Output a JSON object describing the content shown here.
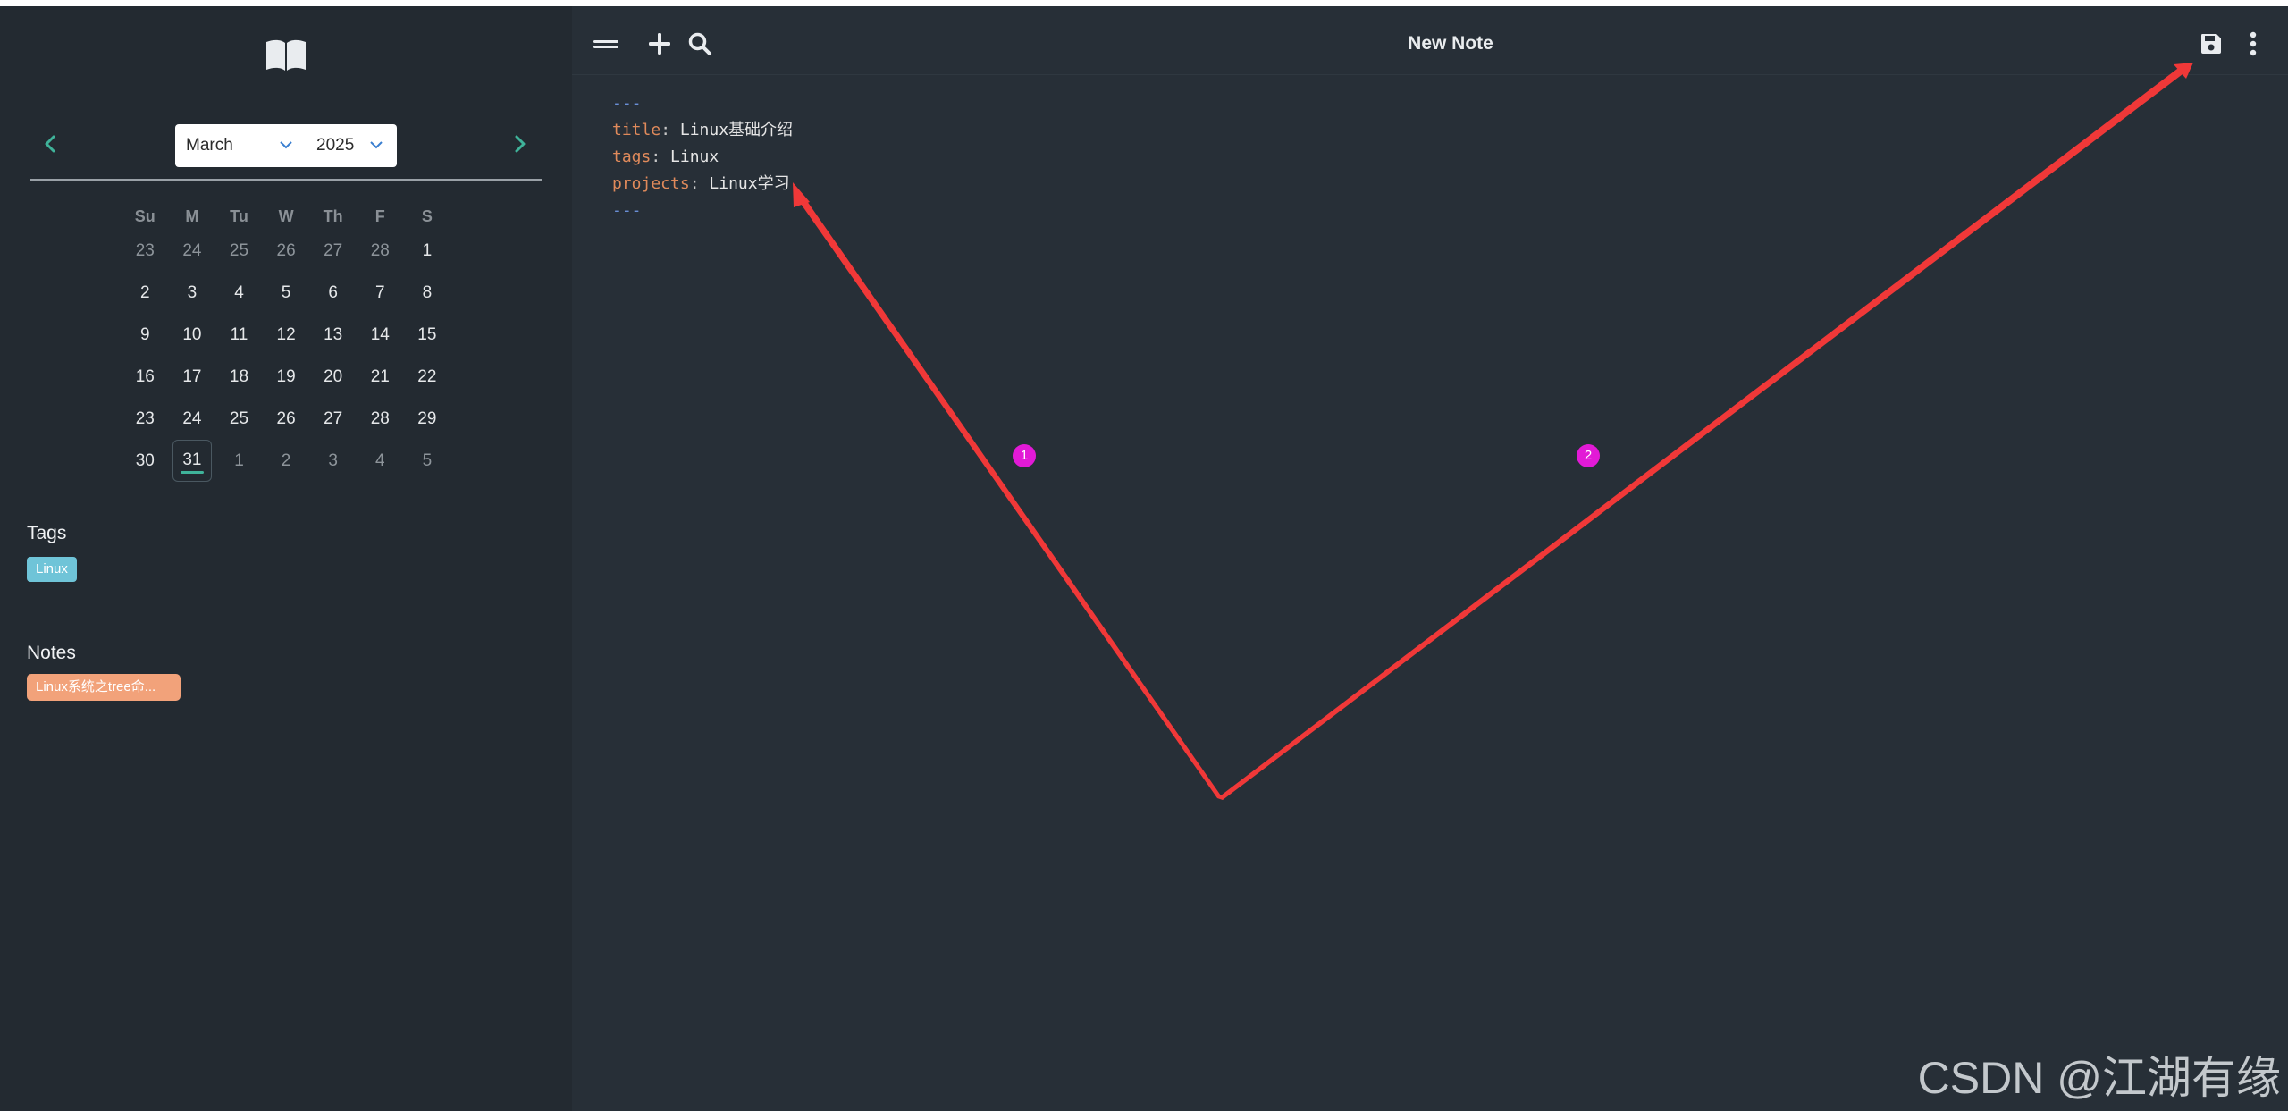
{
  "sidebar": {
    "logo_icon": "open-book-icon",
    "calendar": {
      "prev_icon": "chevron-left-icon",
      "next_icon": "chevron-right-icon",
      "month": "March",
      "year": "2025",
      "weekdays": [
        "Su",
        "M",
        "Tu",
        "W",
        "Th",
        "F",
        "S"
      ],
      "weeks": [
        [
          {
            "d": "23",
            "muted": true
          },
          {
            "d": "24",
            "muted": true
          },
          {
            "d": "25",
            "muted": true
          },
          {
            "d": "26",
            "muted": true
          },
          {
            "d": "27",
            "muted": true
          },
          {
            "d": "28",
            "muted": true
          },
          {
            "d": "1"
          }
        ],
        [
          {
            "d": "2"
          },
          {
            "d": "3"
          },
          {
            "d": "4"
          },
          {
            "d": "5"
          },
          {
            "d": "6"
          },
          {
            "d": "7"
          },
          {
            "d": "8"
          }
        ],
        [
          {
            "d": "9"
          },
          {
            "d": "10"
          },
          {
            "d": "11"
          },
          {
            "d": "12"
          },
          {
            "d": "13"
          },
          {
            "d": "14"
          },
          {
            "d": "15"
          }
        ],
        [
          {
            "d": "16"
          },
          {
            "d": "17"
          },
          {
            "d": "18"
          },
          {
            "d": "19"
          },
          {
            "d": "20"
          },
          {
            "d": "21"
          },
          {
            "d": "22"
          }
        ],
        [
          {
            "d": "23"
          },
          {
            "d": "24"
          },
          {
            "d": "25"
          },
          {
            "d": "26"
          },
          {
            "d": "27"
          },
          {
            "d": "28"
          },
          {
            "d": "29"
          }
        ],
        [
          {
            "d": "30"
          },
          {
            "d": "31",
            "today": true
          },
          {
            "d": "1",
            "muted": true
          },
          {
            "d": "2",
            "muted": true
          },
          {
            "d": "3",
            "muted": true
          },
          {
            "d": "4",
            "muted": true
          },
          {
            "d": "5",
            "muted": true
          }
        ]
      ],
      "accent_color": "#3fb39a"
    },
    "tags_title": "Tags",
    "tags": [
      "Linux"
    ],
    "tag_color": "#6fc4d8",
    "notes_title": "Notes",
    "notes": [
      "Linux系统之tree命..."
    ],
    "note_color": "#f2a27a"
  },
  "toolbar": {
    "menu_icon": "hamburger-menu-icon",
    "add_icon": "plus-icon",
    "search_icon": "search-icon",
    "title": "New Note",
    "save_icon": "save-floppy-icon",
    "more_icon": "more-vertical-icon"
  },
  "editor": {
    "delimiter": "---",
    "lines": [
      {
        "key": "title",
        "value": "Linux基础介绍"
      },
      {
        "key": "tags",
        "value": "Linux"
      },
      {
        "key": "projects",
        "value": "Linux学习"
      }
    ]
  },
  "annotations": {
    "badge_1": "1",
    "badge_2": "2",
    "arrow_color": "#f03838",
    "badge_color": "#e21ad6"
  },
  "watermark": "CSDN @江湖有缘"
}
